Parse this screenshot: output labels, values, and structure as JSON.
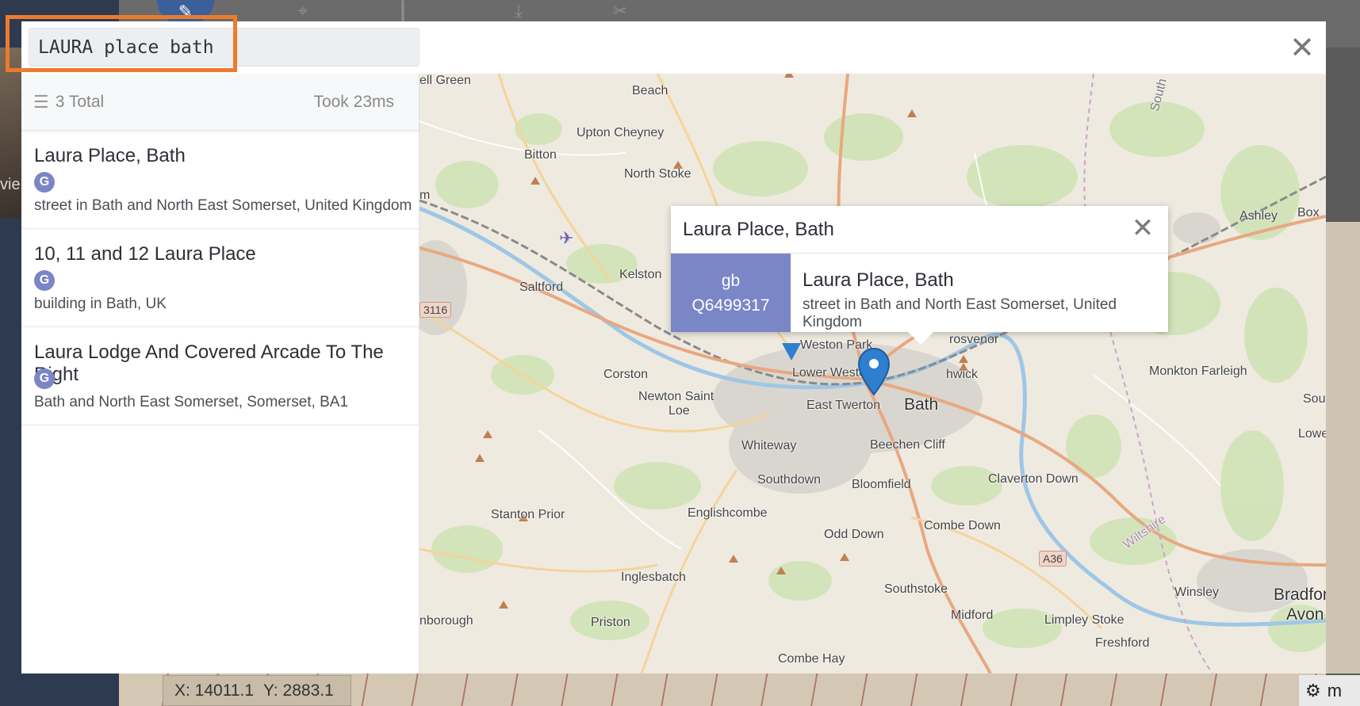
{
  "background": {
    "side_text": "vie",
    "coords": {
      "x": "X: 14011.1",
      "y": "Y: 2883.1"
    },
    "status_text": "m",
    "tool_icons": [
      "pencil-icon",
      "map-pin-icon",
      "chart-icon",
      "download-icon",
      "tools-icon"
    ]
  },
  "search": {
    "value": "LAURA place bath",
    "placeholder": ""
  },
  "close_symbol": "✕",
  "results": {
    "total_label": "3 Total",
    "time_label": "Took 23ms",
    "items": [
      {
        "title": "Laura Place, Bath",
        "source": "G",
        "description": "street in Bath and North East Somerset, United Kingdom"
      },
      {
        "title": "10, 11 and 12 Laura Place",
        "source": "G",
        "description": "building in Bath, UK"
      },
      {
        "title": "Laura Lodge And Covered Arcade To The Right",
        "source": "G",
        "description": "Bath and North East Somerset, Somerset, BA1"
      }
    ]
  },
  "popup": {
    "header_title": "Laura Place, Bath",
    "country_code": "gb",
    "wikidata_id": "Q6499317",
    "title": "Laura Place, Bath",
    "description": "street in Bath and North East Somerset, United Kingdom"
  },
  "map": {
    "labels": {
      "ell_green": "ell Green",
      "beach": "Beach",
      "upton_cheyney": "Upton Cheyney",
      "bitton": "Bitton",
      "north_stoke": "North Stoke",
      "kelston": "Kelston",
      "saltford": "Saltford",
      "m": "m",
      "corston": "Corston",
      "newton_saint_loe_1": "Newton Saint",
      "newton_saint_loe_2": "Loe",
      "weston_park": "Weston Park",
      "lower_weston": "Lower Weston",
      "east_twerton": "East Twerton",
      "bath": "Bath",
      "grosvenor": "rosvenor",
      "bathwick": "hwick",
      "whiteway": "Whiteway",
      "beechen_cliff": "Beechen Cliff",
      "southdown": "Southdown",
      "bloomfield": "Bloomfield",
      "claverton_down": "Claverton Down",
      "stanton_prior": "Stanton Prior",
      "englishcombe": "Englishcombe",
      "odd_down": "Odd Down",
      "combe_down": "Combe Down",
      "inglesbatch": "Inglesbatch",
      "southstoke": "Southstoke",
      "midford": "Midford",
      "limpley_stoke": "Limpley Stoke",
      "freshford": "Freshford",
      "winsley": "Winsley",
      "bradford": "Bradford",
      "avon": "Avon",
      "priston": "Priston",
      "combe_hay": "Combe Hay",
      "nborough": "nborough",
      "monkton_farleigh": "Monkton Farleigh",
      "ashley": "Ashley",
      "box": "Box",
      "lower_w": "Lower W",
      "south": "Sout",
      "wiltshire": "Wiltshire",
      "south_vertical": "South"
    },
    "shields": {
      "a3116": "3116",
      "a36": "A36"
    },
    "colors": {
      "accent": "#7a86c6",
      "marker": "#2f7fd0",
      "highlight": "#ee7a2c"
    }
  }
}
